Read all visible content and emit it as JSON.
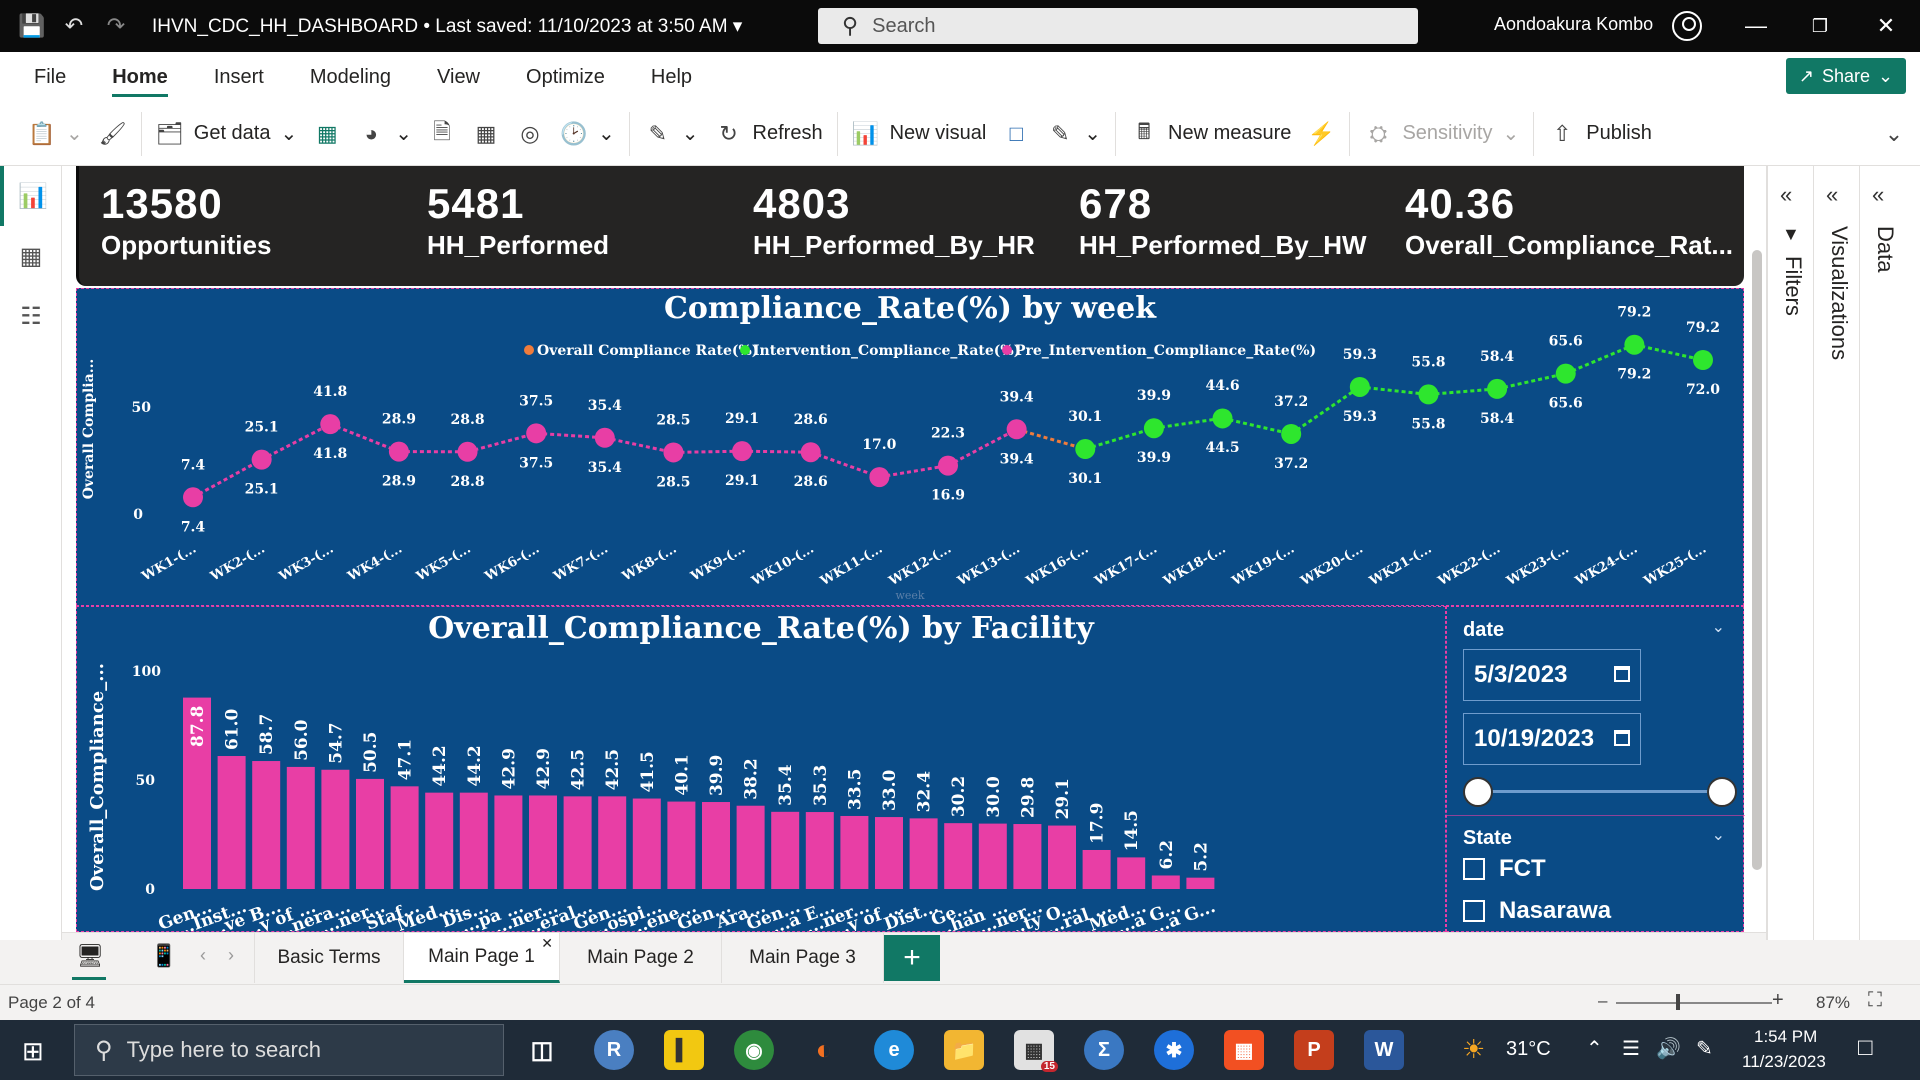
{
  "window": {
    "doc_title": "IHVN_CDC_HH_DASHBOARD",
    "saved": "• Last saved: 11/10/2023 at 3:50 AM",
    "search_placeholder": "Search",
    "user": "Aondoakura Kombo"
  },
  "menu": [
    "File",
    "Home",
    "Insert",
    "Modeling",
    "View",
    "Optimize",
    "Help"
  ],
  "share_label": "Share",
  "ribbon": {
    "get_data": "Get data",
    "refresh": "Refresh",
    "new_visual": "New visual",
    "new_measure": "New measure",
    "sensitivity": "Sensitivity",
    "publish": "Publish"
  },
  "kpis": [
    {
      "value": "13580",
      "label": "Opportunities"
    },
    {
      "value": "5481",
      "label": "HH_Performed"
    },
    {
      "value": "4803",
      "label": "HH_Performed_By_HR"
    },
    {
      "value": "678",
      "label": "HH_Performed_By_HW"
    },
    {
      "value": "40.36",
      "label": "Overall_Compliance_Rat..."
    }
  ],
  "chart_data": [
    {
      "type": "line",
      "title": "Compliance_Rate(%) by week",
      "xlabel": "week",
      "ylabel": "Overall Complia...",
      "ylim": [
        0,
        80
      ],
      "y_ticks": [
        "0",
        "50"
      ],
      "categories": [
        "WK1-(...",
        "WK2-(...",
        "WK3-(...",
        "WK4-(...",
        "WK5-(...",
        "WK6-(...",
        "WK7-(...",
        "WK8-(...",
        "WK9-(...",
        "WK10-(...",
        "WK11-(...",
        "WK12-(...",
        "WK13-(...",
        "WK16-(...",
        "WK17-(...",
        "WK18-(...",
        "WK19-(...",
        "WK20-(...",
        "WK21-(...",
        "WK22-(...",
        "WK23-(...",
        "WK24-(...",
        "WK25-(..."
      ],
      "legend": [
        "Overall Compliance Rate(%)",
        "Intervention_Compliance_Rate(%)",
        "Pre_Intervention_Compliance_Rate(%)"
      ],
      "legend_colors": [
        "#f07c3c",
        "#2ee62e",
        "#e83ea5"
      ],
      "legend_placement": "top",
      "series": [
        {
          "name": "Overall Compliance Rate(%)",
          "values": [
            7.4,
            25.1,
            41.8,
            28.9,
            28.8,
            37.5,
            35.4,
            28.5,
            29.1,
            28.6,
            17.0,
            22.3,
            39.4,
            30.1,
            39.9,
            44.6,
            37.2,
            59.3,
            55.8,
            58.4,
            65.6,
            79.2,
            72.0
          ]
        },
        {
          "name": "Pre_Intervention_Compliance_Rate(%)",
          "values": [
            7.4,
            25.1,
            41.8,
            28.9,
            28.8,
            37.5,
            35.4,
            28.5,
            29.1,
            28.6,
            16.9,
            22.3,
            39.4,
            null,
            null,
            null,
            null,
            null,
            null,
            null,
            null,
            null,
            null
          ]
        },
        {
          "name": "Intervention_Compliance_Rate(%)",
          "values": [
            null,
            null,
            null,
            null,
            null,
            null,
            null,
            null,
            null,
            null,
            null,
            null,
            null,
            30.1,
            39.9,
            44.5,
            37.2,
            59.3,
            55.8,
            58.4,
            65.6,
            79.2,
            72.0
          ]
        }
      ],
      "labels_above": [
        "7.4",
        "25.1",
        "41.8",
        "28.9",
        "28.8",
        "37.5",
        "35.4",
        "28.5",
        "29.1",
        "28.6",
        "17.0",
        "22.3",
        "39.4",
        "30.1",
        "39.9",
        "44.6",
        "37.2",
        "59.3",
        "55.8",
        "58.4",
        "65.6",
        "79.2",
        "79.2"
      ],
      "labels_below": [
        "7.4",
        "25.1",
        "41.8",
        "28.9",
        "28.8",
        "37.5",
        "35.4",
        "28.5",
        "29.1",
        "28.6",
        "",
        "16.9",
        "39.4",
        "30.1",
        "39.9",
        "44.5",
        "37.2",
        "59.3",
        "55.8",
        "58.4",
        "65.6",
        "79.2",
        "72.0"
      ]
    },
    {
      "type": "bar",
      "title": "Overall_Compliance_Rate(%) by Facility",
      "ylabel": "Overall_Compliance_...",
      "ylim": [
        0,
        100
      ],
      "y_ticks": [
        "0",
        "50",
        "100"
      ],
      "bar_color": "#e83ea5",
      "categories": [
        "Gen...",
        "...Inst...",
        "...ve B...",
        "...y of ...",
        "...nera...",
        "...ner...",
        "Staf...",
        "Med...",
        "Dis...",
        "...pa ...",
        "...ner...",
        "...eral...",
        "Gen...",
        "...ospi...",
        "...ene...",
        "Gen...",
        "Ara...",
        "Gen...",
        "...a E...",
        "...ner...",
        "...y of ...",
        "Dist...",
        "Ge...",
        "...han ...",
        "...ner...",
        "...ty O...",
        "...ral ...",
        "Med...",
        "...a G...",
        "...a G..."
      ],
      "values": [
        87.8,
        61.0,
        58.7,
        56.0,
        54.7,
        50.5,
        47.1,
        44.2,
        44.2,
        42.9,
        42.9,
        42.5,
        42.5,
        41.5,
        40.1,
        39.9,
        38.2,
        35.4,
        35.3,
        33.5,
        33.0,
        32.4,
        30.2,
        30.0,
        29.8,
        29.1,
        17.9,
        14.5,
        6.2,
        5.2
      ]
    }
  ],
  "slicers": {
    "date_title": "date",
    "date_from": "5/3/2023",
    "date_to": "10/19/2023",
    "state_title": "State",
    "states": [
      "FCT",
      "Nasarawa"
    ]
  },
  "panes": {
    "filters": "Filters",
    "visualizations": "Visualizations",
    "data": "Data"
  },
  "page_tabs": [
    "Basic Terms",
    "Main Page 1",
    "Main Page 2",
    "Main Page 3"
  ],
  "active_tab": "Main Page 1",
  "status": {
    "page": "Page 2 of 4",
    "zoom": "87%"
  },
  "taskbar": {
    "search_placeholder": "Type here to search",
    "weather": "31°C",
    "time": "1:54 PM",
    "date": "11/23/2023",
    "badge": "15"
  }
}
